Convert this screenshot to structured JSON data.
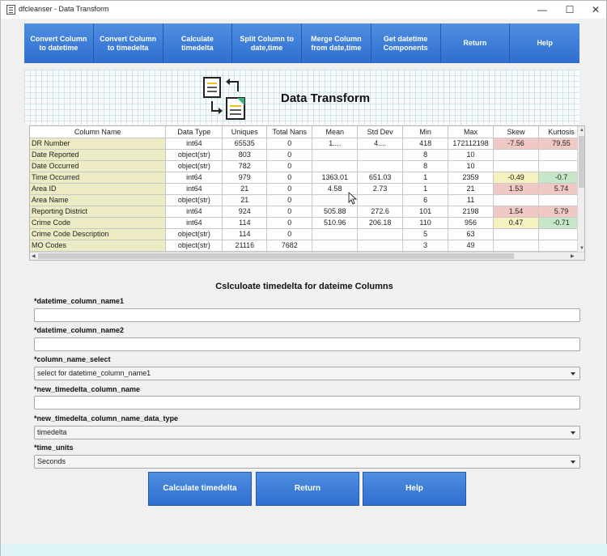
{
  "window": {
    "title": "dfcleanser - Data Transform",
    "minimize": "—",
    "maximize": "☐",
    "close": "✕"
  },
  "toolbar": [
    "Convert Column to datetime",
    "Convert Column to timedelta",
    "Calculate timedelta",
    "Split Column to date,time",
    "Merge Column from date,time",
    "Get datetime Components",
    "Return",
    "Help"
  ],
  "banner": {
    "title": "Data Transform",
    "icon": "data-transform-icon"
  },
  "table": {
    "headers": [
      "Column Name",
      "Data Type",
      "Uniques",
      "Total Nans",
      "Mean",
      "Std Dev",
      "Min",
      "Max",
      "Skew",
      "Kurtosis"
    ],
    "rows": [
      [
        "DR Number",
        "int64",
        "65535",
        "0",
        "1....",
        "4....",
        "418",
        "172112198",
        "-7.56",
        "79.55"
      ],
      [
        "Date Reported",
        "object(str)",
        "803",
        "0",
        "",
        "",
        "8",
        "10",
        "",
        ""
      ],
      [
        "Date Occurred",
        "object(str)",
        "782",
        "0",
        "",
        "",
        "8",
        "10",
        "",
        ""
      ],
      [
        "Time Occurred",
        "int64",
        "979",
        "0",
        "1363.01",
        "651.03",
        "1",
        "2359",
        "-0.49",
        "-0.7"
      ],
      [
        "Area ID",
        "int64",
        "21",
        "0",
        "4.58",
        "2.73",
        "1",
        "21",
        "1.53",
        "5.74"
      ],
      [
        "Area Name",
        "object(str)",
        "21",
        "0",
        "",
        "",
        "6",
        "11",
        "",
        ""
      ],
      [
        "Reporting District",
        "int64",
        "924",
        "0",
        "505.88",
        "272.6",
        "101",
        "2198",
        "1.54",
        "5.79"
      ],
      [
        "Crime Code",
        "int64",
        "114",
        "0",
        "510.96",
        "206.18",
        "110",
        "956",
        "0.47",
        "-0.71"
      ],
      [
        "Crime Code Description",
        "object(str)",
        "114",
        "0",
        "",
        "",
        "5",
        "63",
        "",
        ""
      ],
      [
        "MO Codes",
        "object(str)",
        "21116",
        "7682",
        "",
        "",
        "3",
        "49",
        "",
        ""
      ]
    ],
    "skew_colors": [
      "red",
      "",
      "",
      "yellow",
      "red",
      "",
      "red",
      "yellow",
      "",
      ""
    ],
    "kurtosis_colors": [
      "red",
      "",
      "",
      "green",
      "red",
      "",
      "red",
      "green",
      "",
      ""
    ]
  },
  "form": {
    "title": "Cslculoate timedelta for dateime Columns",
    "field1_label": "*datetime_column_name1",
    "field1_value": "",
    "field2_label": "*datetime_column_name2",
    "field2_value": "",
    "select_label": "*column_name_select",
    "select_value": "select for datetime_column_name1",
    "newcol_label": "*new_timedelta_column_name",
    "newcol_value": "",
    "dtype_label": "*new_timedelta_column_name_data_type",
    "dtype_value": "timedelta",
    "units_label": "*time_units",
    "units_value": "Seconds"
  },
  "buttons": {
    "calculate": "Calculate timedelta",
    "return": "Return",
    "help": "Help"
  },
  "colors": {
    "accent": "#3a7bd5",
    "red": "#f1c9c4",
    "yellow": "#f5f2bf",
    "green": "#c7e8c8",
    "colname": "#ecebc4"
  }
}
